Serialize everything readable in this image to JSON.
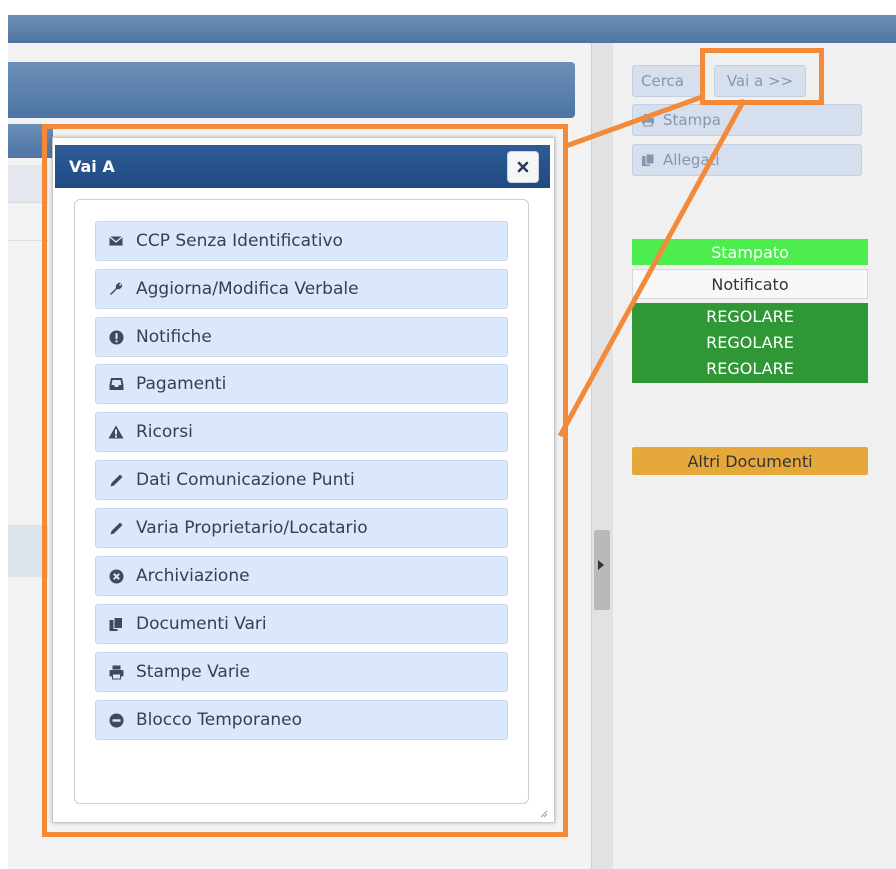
{
  "toolbar": {
    "cerca_label": "Cerca",
    "vaia_label": "Vai a >>",
    "stampa_label": "Stampa",
    "allegati_label": "Allegati"
  },
  "status": {
    "stampato": "Stampato",
    "notificato": "Notificato",
    "regolare": [
      "REGOLARE",
      "REGOLARE",
      "REGOLARE"
    ],
    "altri_documenti": "Altri Documenti"
  },
  "dialog": {
    "title": "Vai A",
    "items": [
      {
        "label": "CCP Senza Identificativo",
        "icon": "envelope-icon"
      },
      {
        "label": "Aggiorna/Modifica Verbale",
        "icon": "wrench-icon"
      },
      {
        "label": "Notifiche",
        "icon": "exclamation-circle-icon"
      },
      {
        "label": "Pagamenti",
        "icon": "inbox-icon"
      },
      {
        "label": "Ricorsi",
        "icon": "warning-triangle-icon"
      },
      {
        "label": "Dati Comunicazione Punti",
        "icon": "pencil-icon"
      },
      {
        "label": "Varia Proprietario/Locatario",
        "icon": "pencil-icon"
      },
      {
        "label": "Archiviazione",
        "icon": "times-circle-icon"
      },
      {
        "label": "Documenti Vari",
        "icon": "files-icon"
      },
      {
        "label": "Stampe Varie",
        "icon": "print-icon"
      },
      {
        "label": "Blocco Temporaneo",
        "icon": "minus-circle-icon"
      }
    ]
  },
  "colors": {
    "highlight": "#f28a3a",
    "dialog_header": "#1f4a82",
    "stampato": "#4ced4c",
    "regolare": "#2f9735",
    "altri_documenti": "#e6a83a"
  }
}
